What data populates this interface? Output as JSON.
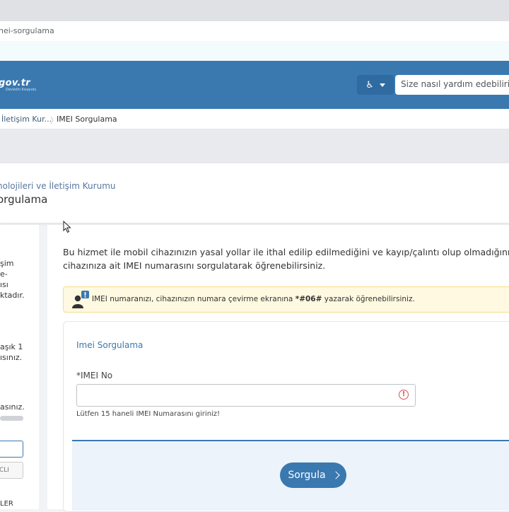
{
  "browser": {
    "url_fragment": "nei-sorgulama"
  },
  "header": {
    "logo_text": "gov.tr",
    "logo_tagline": "Devletin Kısayolu",
    "a11y_symbol": "♿",
    "search_placeholder": "Size nasıl yardım edebilirim?"
  },
  "breadcrumb": {
    "items": [
      "İletişim Kur...",
      "IMEI Sorgulama"
    ],
    "separator": "〉"
  },
  "title_panel": {
    "institution": "nolojileri ve İletişim Kurumu",
    "title": "orgulama"
  },
  "sidebar": {
    "block1": "şim\ne-\nısı\nktadır.",
    "block2": "aşık 1\nısınız.",
    "block3": "asınız.",
    "button_text": "CLI",
    "footer_text": "LER"
  },
  "main": {
    "description": "Bu hizmet ile mobil cihazınızın yasal yollar ile ithal edilip edilmediğini ve kayıp/çalıntı olup olmadığını, cihazınıza ait IMEI numarasını sorgulatarak öğrenebilirsiniz.",
    "info": {
      "before": "IMEI numaranızı, cihazınızın numara çevirme ekranına ",
      "code": "*#06#",
      "after": " yazarak öğrenebilirsiniz."
    },
    "form": {
      "title": "Imei Sorgulama",
      "field_label": "*IMEI No",
      "field_value": "",
      "error_symbol": "!",
      "hint": "Lütfen 15 haneli IMEI Numarasını giriniz!",
      "submit_label": "Sorgula"
    }
  },
  "colors": {
    "header": "#3a78b0",
    "accent": "#3a78b0",
    "info_bg": "#fef9e0",
    "error": "#d9534f"
  }
}
